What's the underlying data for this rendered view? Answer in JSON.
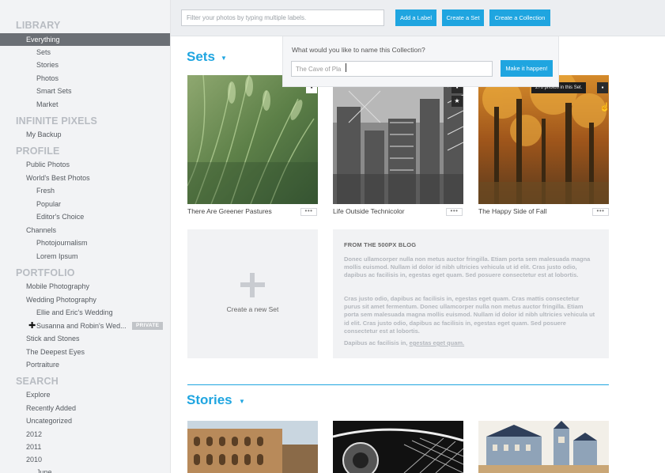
{
  "sidebar": {
    "library": {
      "heading": "LIBRARY",
      "everything": "Everything",
      "sets": "Sets",
      "stories": "Stories",
      "photos": "Photos",
      "smart_sets": "Smart Sets",
      "market": "Market"
    },
    "infinite": {
      "heading": "INFINITE PIXELS",
      "my_backup": "My Backup"
    },
    "profile": {
      "heading": "PROFILE",
      "public_photos": "Public Photos",
      "worlds_best": "World's Best Photos",
      "fresh": "Fresh",
      "popular": "Popular",
      "editors_choice": "Editor's Choice",
      "channels": "Channels",
      "photojournalism": "Photojournalism",
      "lorem_ipsum": "Lorem Ipsum"
    },
    "portfolio": {
      "heading": "PORTFOLIO",
      "mobile": "Mobile Photography",
      "wedding": "Wedding Photography",
      "ellie": "Ellie and Eric's Wedding",
      "susanna": "Susanna and Robin's Wed...",
      "private_badge": "PRIVATE",
      "stick": "Stick and Stones",
      "deepest": "The Deepest Eyes",
      "portraiture": "Portraiture"
    },
    "search": {
      "heading": "SEARCH",
      "explore": "Explore",
      "recently_added": "Recently Added",
      "uncategorized": "Uncategorized",
      "y2012": "2012",
      "y2011": "2011",
      "y2010": "2010",
      "june": "June"
    }
  },
  "toolbar": {
    "filter_placeholder": "Filter your photos by typing multiple labels.",
    "add_label": "Add a Label",
    "create_set": "Create a Set",
    "create_collection": "Create a Collection"
  },
  "popover": {
    "question": "What would you like to name this Collection?",
    "input_value": "The Cave of Pla",
    "submit": "Make it happen!"
  },
  "sets": {
    "title": "Sets",
    "items": [
      {
        "caption": "There Are Greener Pastures",
        "more": "•••"
      },
      {
        "caption": "Life Outside Technicolor",
        "more": "•••"
      },
      {
        "caption": "The Happy Side of Fall",
        "more": "•••"
      }
    ],
    "tooltip": "276 photos in this Set.",
    "new_set": "Create a new Set"
  },
  "blog": {
    "title": "FROM THE 500PX BLOG",
    "p1": "Donec ullamcorper nulla non metus auctor fringilla. Etiam porta sem malesuada magna mollis euismod. Nullam id dolor id nibh ultricies vehicula ut id elit. Cras justo odio, dapibus ac facilisis in, egestas eget quam. Sed posuere consectetur est at lobortis.",
    "p2": "Cras justo odio, dapibus ac facilisis in, egestas eget quam. Cras mattis consectetur purus sit amet fermentum. Donec ullamcorper nulla non metus auctor fringilla. Etiam porta sem malesuada magna mollis euismod. Nullam id dolor id nibh ultricies vehicula ut id elit. Cras justo odio, dapibus ac facilisis in, egestas eget quam. Sed posuere consectetur est at lobortis.",
    "p3_pre": "Dapibus ac facilisis in, ",
    "p3_link": "egestas eget quam."
  },
  "stories": {
    "title": "Stories"
  },
  "colors": {
    "accent": "#1fa5e0",
    "sidebar_bg": "#f2f3f5",
    "active_bg": "#6b6f75"
  }
}
